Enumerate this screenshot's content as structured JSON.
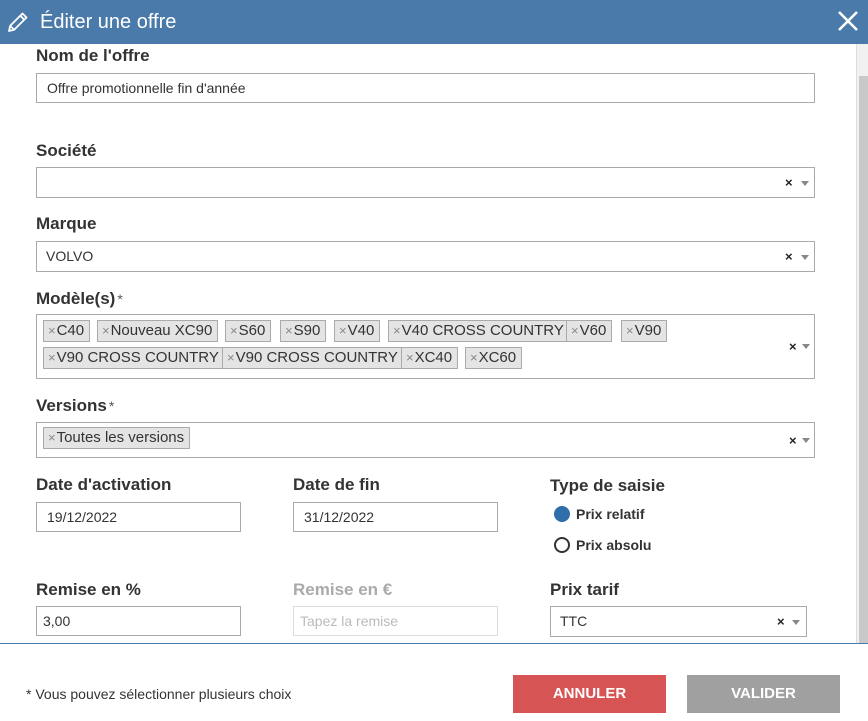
{
  "dialog": {
    "title": "Éditer une offre",
    "icons": {
      "edit": "pencil-icon",
      "close": "close-icon"
    }
  },
  "form": {
    "offer_name": {
      "label": "Nom de l'offre",
      "value": "Offre promotionnelle fin d'année"
    },
    "company": {
      "label": "Société",
      "value": "",
      "clear": "×"
    },
    "brand": {
      "label": "Marque",
      "value": "VOLVO",
      "clear": "×"
    },
    "models": {
      "label": "Modèle(s)",
      "required": "*",
      "clear": "×",
      "tags": [
        "C40",
        "Nouveau XC90",
        "S60",
        "S90",
        "V40",
        "V40 CROSS COUNTRY",
        "V60",
        "V90",
        "V90 CROSS COUNTRY",
        "V90 CROSS COUNTRY",
        "XC40",
        "XC60"
      ]
    },
    "versions": {
      "label": "Versions",
      "required": "*",
      "clear": "×",
      "tags": [
        "Toutes les versions"
      ]
    },
    "start_date": {
      "label": "Date d'activation",
      "value": "19/12/2022"
    },
    "end_date": {
      "label": "Date de fin",
      "value": "31/12/2022"
    },
    "entry_type": {
      "label": "Type de saisie",
      "options": [
        {
          "label": "Prix relatif",
          "selected": true
        },
        {
          "label": "Prix absolu",
          "selected": false
        }
      ]
    },
    "discount_percent": {
      "label": "Remise en %",
      "value": "3,00"
    },
    "discount_euro": {
      "label": "Remise en €",
      "placeholder": "Tapez la remise",
      "disabled": true
    },
    "price_list": {
      "label": "Prix tarif",
      "value": "TTC",
      "clear": "×"
    }
  },
  "footer": {
    "note": "* Vous pouvez sélectionner plusieurs choix",
    "cancel_label": "ANNULER",
    "submit_label": "VALIDER"
  },
  "colors": {
    "header": "#4a7aaa",
    "cancel": "#d65454",
    "submit": "#a0a0a0",
    "radio_selected": "#2f6ea8"
  }
}
